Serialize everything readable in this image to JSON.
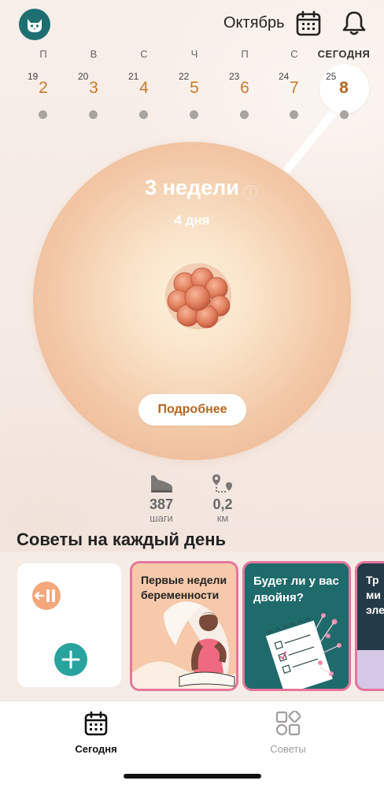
{
  "header": {
    "month": "Октябрь",
    "icons": [
      "cat-avatar-icon",
      "calendar-icon",
      "bell-icon"
    ]
  },
  "week": {
    "days": [
      {
        "dow": "П",
        "small": "19",
        "big": "2"
      },
      {
        "dow": "В",
        "small": "20",
        "big": "3"
      },
      {
        "dow": "С",
        "small": "21",
        "big": "4"
      },
      {
        "dow": "Ч",
        "small": "22",
        "big": "5"
      },
      {
        "dow": "П",
        "small": "23",
        "big": "6"
      },
      {
        "dow": "С",
        "small": "24",
        "big": "7"
      },
      {
        "dow": "СЕГОДНЯ",
        "small": "25",
        "big": "8"
      }
    ]
  },
  "hero": {
    "weeks": "3 недели",
    "days": "4 дня",
    "more_button": "Подробнее"
  },
  "stats": {
    "steps_value": "387",
    "steps_unit": "шаги",
    "distance_value": "0,2",
    "distance_unit": "км"
  },
  "tips": {
    "title": "Советы на каждый день",
    "cards": [
      {
        "text": "Первые недели беременности"
      },
      {
        "text": "Будет ли у вас двойня?"
      },
      {
        "text": "Тр\nми\nэле"
      }
    ]
  },
  "nav": {
    "today": "Сегодня",
    "tips": "Советы"
  },
  "colors": {
    "accent_orange": "#c77a2c",
    "teal": "#1e6f72",
    "pink_border": "#e6759c"
  }
}
